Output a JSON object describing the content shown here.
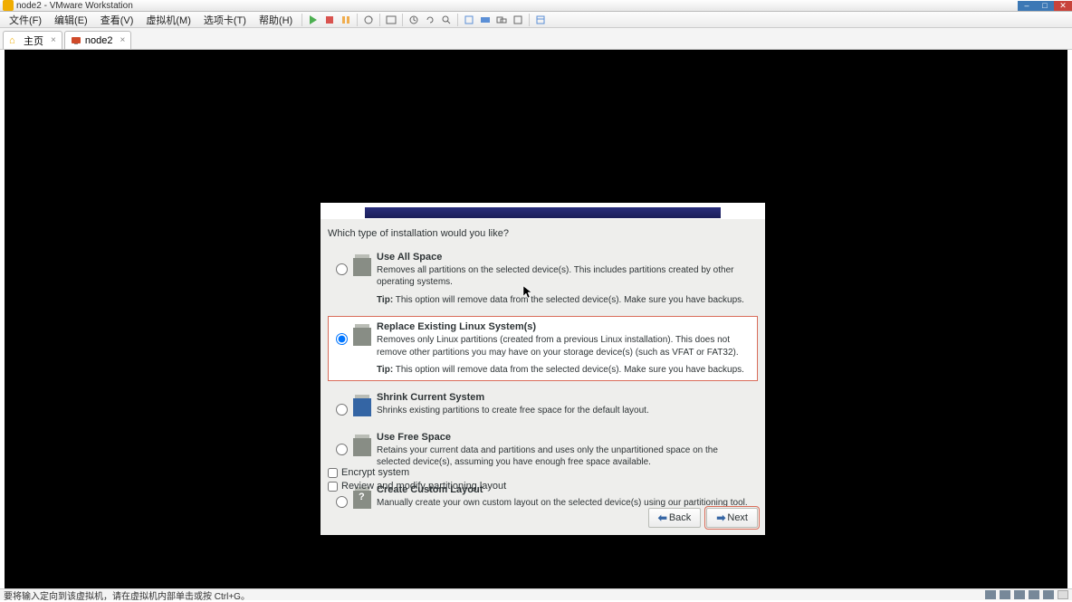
{
  "window": {
    "title": "node2 - VMware Workstation"
  },
  "menu": {
    "file": "文件(F)",
    "edit": "编辑(E)",
    "view": "查看(V)",
    "vm": "虚拟机(M)",
    "tabs": "选项卡(T)",
    "help": "帮助(H)"
  },
  "tabs": {
    "home": "主页",
    "node2": "node2"
  },
  "installer": {
    "question": "Which type of installation would you like?",
    "options": [
      {
        "title": "Use All Space",
        "desc": "Removes all partitions on the selected device(s).  This includes partitions created by other operating systems.",
        "tip_label": "Tip:",
        "tip": " This option will remove data from the selected device(s).  Make sure you have backups."
      },
      {
        "title": "Replace Existing Linux System(s)",
        "desc": "Removes only Linux partitions (created from a previous Linux installation).  This does not remove other partitions you may have on your storage device(s) (such as VFAT or FAT32).",
        "tip_label": "Tip:",
        "tip": " This option will remove data from the selected device(s).  Make sure you have backups."
      },
      {
        "title": "Shrink Current System",
        "desc": "Shrinks existing partitions to create free space for the default layout."
      },
      {
        "title": "Use Free Space",
        "desc": "Retains your current data and partitions and uses only the unpartitioned space on the selected device(s), assuming you have enough free space available."
      },
      {
        "title": "Create Custom Layout",
        "desc": "Manually create your own custom layout on the selected device(s) using our partitioning tool."
      }
    ],
    "selected_index": 1,
    "checkboxes": {
      "encrypt": "Encrypt system",
      "review": "Review and modify partitioning layout"
    },
    "buttons": {
      "back": "Back",
      "next": "Next"
    }
  },
  "status_bar": {
    "text": "要将输入定向到该虚拟机，请在虚拟机内部单击或按 Ctrl+G。"
  },
  "icons": {
    "home": "home-icon",
    "vm": "vm-icon",
    "play": "play-icon",
    "stop": "stop-icon",
    "pause": "pause-icon"
  }
}
